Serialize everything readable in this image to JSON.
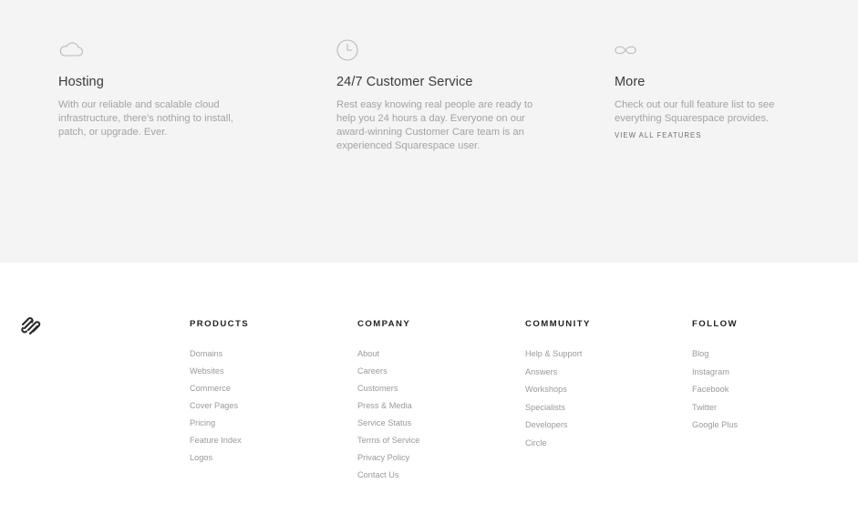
{
  "features": [
    {
      "icon": "cloud-icon",
      "title": "Hosting",
      "description": "With our reliable and scalable cloud infrastructure, there's nothing to install, patch, or upgrade. Ever.",
      "link": ""
    },
    {
      "icon": "clock-icon",
      "title": "24/7 Customer Service",
      "description": "Rest easy knowing real people are ready to help you 24 hours a day. Everyone on our award-winning Customer Care team is an experienced Squarespace user.",
      "link": ""
    },
    {
      "icon": "infinity-icon",
      "title": "More",
      "description": "Check out our full feature list to see everything Squarespace provides.",
      "link": "VIEW ALL FEATURES"
    }
  ],
  "footer": {
    "logo_icon": "squarespace-logo-icon",
    "columns": [
      {
        "heading": "PRODUCTS",
        "links": [
          "Domains",
          "Websites",
          "Commerce",
          "Cover Pages",
          "Pricing",
          "Feature Index",
          "Logos"
        ]
      },
      {
        "heading": "COMPANY",
        "links": [
          "About",
          "Careers",
          "Customers",
          "Press & Media",
          "Service Status",
          "Terms of Service",
          "Privacy Policy",
          "Contact Us"
        ]
      },
      {
        "heading": "COMMUNITY",
        "links": [
          "Help & Support",
          "Answers",
          "Workshops",
          "Specialists",
          "Developers",
          "Circle"
        ]
      },
      {
        "heading": "FOLLOW",
        "links": [
          "Blog",
          "Instagram",
          "Facebook",
          "Twitter",
          "Google Plus"
        ]
      }
    ]
  }
}
